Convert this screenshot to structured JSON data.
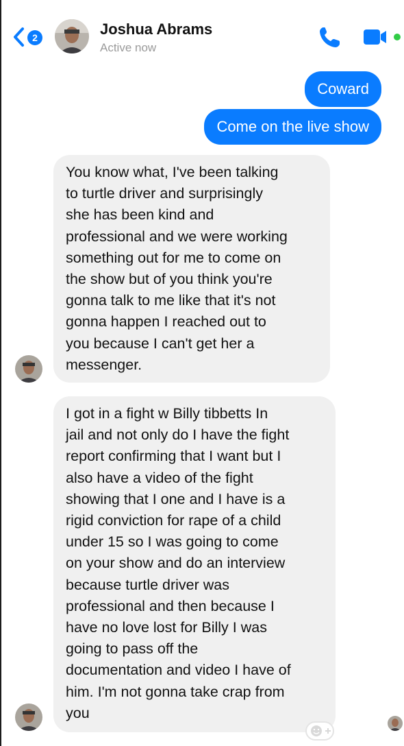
{
  "header": {
    "unread_count": "2",
    "contact_name": "Joshua Abrams",
    "status": "Active now",
    "accent_color": "#0a7cff",
    "online_color": "#31cc46",
    "icons": [
      "back-chevron-icon",
      "phone-icon",
      "video-camera-icon"
    ]
  },
  "messages": {
    "outgoing": [
      {
        "text": "Coward"
      },
      {
        "text": "Come on the live show"
      }
    ],
    "incoming_1": {
      "lines": [
        "You know what, I've been talking",
        "to turtle driver and surprisingly",
        "she has been kind and",
        "professional and we were working",
        "something out for me to come on",
        "the show but of you think you're",
        "gonna talk to me like that it's not",
        "gonna happen I reached out to",
        "you because I can't get her a",
        "messenger."
      ]
    },
    "incoming_2": {
      "lines": [
        "I got in a fight w Billy tibbetts  In",
        "jail and not only do I have the fight",
        "report confirming that I want but I",
        "also have a video of the fight",
        "showing that I one and I have is a",
        "rigid conviction for rape of a child",
        "under 15 so I was going to come",
        "on your show and do an interview",
        "because turtle driver was",
        "professional and then because I",
        "have no love lost for Billy I was",
        "going to pass off the",
        "documentation and video I have of",
        "him. I'm not gonna take crap from",
        "you"
      ]
    }
  },
  "reaction": {
    "icon": "add-reaction-icon"
  }
}
